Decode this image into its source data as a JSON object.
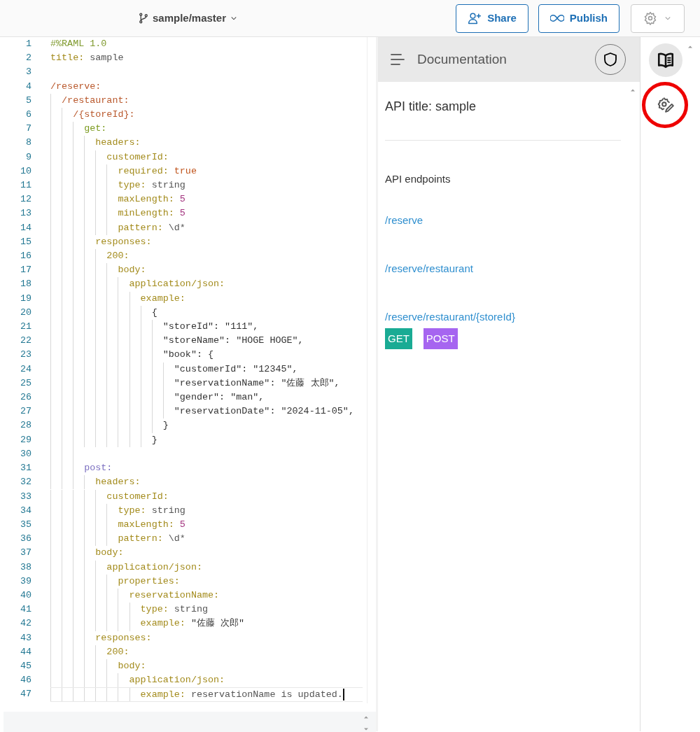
{
  "topbar": {
    "branch": "sample/master",
    "buttons": [
      {
        "kind": "share",
        "label": "Share"
      },
      {
        "kind": "publish",
        "label": "Publish"
      }
    ]
  },
  "editor": {
    "lines": [
      {
        "no": "1",
        "cursor": false,
        "tokens": [
          {
            "kind": "header",
            "text": "#%RAML 1.0"
          }
        ]
      },
      {
        "no": "2",
        "cursor": false,
        "tokens": [
          {
            "kind": "key",
            "text": "title:"
          },
          {
            "kind": "value",
            "text": " sample"
          }
        ]
      },
      {
        "no": "3",
        "cursor": false
      },
      {
        "no": "4",
        "cursor": false,
        "tokens": [
          {
            "kind": "resource",
            "text": "/reserve:"
          }
        ]
      },
      {
        "no": "5",
        "cursor": false,
        "tokens": [
          {
            "kind": "resource",
            "text": "  /restaurant:"
          }
        ]
      },
      {
        "no": "6",
        "cursor": false,
        "tokens": [
          {
            "kind": "resource",
            "text": "    /{storeId}:"
          }
        ]
      },
      {
        "no": "7",
        "cursor": false,
        "tokens": [
          {
            "kind": "get",
            "text": "      get:"
          }
        ]
      },
      {
        "no": "8",
        "cursor": false,
        "tokens": [
          {
            "kind": "key",
            "text": "        headers:"
          }
        ]
      },
      {
        "no": "9",
        "cursor": false,
        "tokens": [
          {
            "kind": "key",
            "text": "          customerId:"
          }
        ]
      },
      {
        "no": "10",
        "cursor": false,
        "tokens": [
          {
            "kind": "key",
            "text": "            required:"
          },
          {
            "kind": "bool",
            "text": " true"
          }
        ]
      },
      {
        "no": "11",
        "cursor": false,
        "tokens": [
          {
            "kind": "key",
            "text": "            type:"
          },
          {
            "kind": "value",
            "text": " string"
          }
        ]
      },
      {
        "no": "12",
        "cursor": false,
        "tokens": [
          {
            "kind": "key",
            "text": "            maxLength:"
          },
          {
            "kind": "number",
            "text": " 5"
          }
        ]
      },
      {
        "no": "13",
        "cursor": false,
        "tokens": [
          {
            "kind": "key",
            "text": "            minLength:"
          },
          {
            "kind": "number",
            "text": " 5"
          }
        ]
      },
      {
        "no": "14",
        "cursor": false,
        "tokens": [
          {
            "kind": "key",
            "text": "            pattern:"
          },
          {
            "kind": "value",
            "text": " \\d*"
          }
        ]
      },
      {
        "no": "15",
        "cursor": false,
        "tokens": [
          {
            "kind": "key",
            "text": "        responses:"
          }
        ]
      },
      {
        "no": "16",
        "cursor": false,
        "tokens": [
          {
            "kind": "key",
            "text": "          200:"
          }
        ]
      },
      {
        "no": "17",
        "cursor": false,
        "tokens": [
          {
            "kind": "key",
            "text": "            body:"
          }
        ]
      },
      {
        "no": "18",
        "cursor": false,
        "tokens": [
          {
            "kind": "key",
            "text": "              application/json:"
          }
        ]
      },
      {
        "no": "19",
        "cursor": false,
        "tokens": [
          {
            "kind": "key",
            "text": "                example:"
          }
        ]
      },
      {
        "no": "20",
        "cursor": false,
        "tokens": [
          {
            "kind": "json",
            "text": "                  {"
          }
        ]
      },
      {
        "no": "21",
        "cursor": false,
        "tokens": [
          {
            "kind": "json",
            "text": "                    \"storeId\": \"111\","
          }
        ]
      },
      {
        "no": "22",
        "cursor": false,
        "tokens": [
          {
            "kind": "json",
            "text": "                    \"storeName\": \"HOGE HOGE\","
          }
        ]
      },
      {
        "no": "23",
        "cursor": false,
        "tokens": [
          {
            "kind": "json",
            "text": "                    \"book\": {"
          }
        ]
      },
      {
        "no": "24",
        "cursor": false,
        "tokens": [
          {
            "kind": "json",
            "text": "                      \"customerId\": \"12345\","
          }
        ]
      },
      {
        "no": "25",
        "cursor": false,
        "tokens": [
          {
            "kind": "json",
            "text": "                      \"reservationName\": \"佐藤 太郎\","
          }
        ]
      },
      {
        "no": "26",
        "cursor": false,
        "tokens": [
          {
            "kind": "json",
            "text": "                      \"gender\": \"man\","
          }
        ]
      },
      {
        "no": "27",
        "cursor": false,
        "tokens": [
          {
            "kind": "json",
            "text": "                      \"reservationDate\": \"2024-11-05\","
          }
        ]
      },
      {
        "no": "28",
        "cursor": false,
        "tokens": [
          {
            "kind": "json",
            "text": "                    }"
          }
        ]
      },
      {
        "no": "29",
        "cursor": false,
        "tokens": [
          {
            "kind": "json",
            "text": "                  }"
          }
        ]
      },
      {
        "no": "30",
        "cursor": false
      },
      {
        "no": "31",
        "cursor": false,
        "tokens": [
          {
            "kind": "post",
            "text": "      post:"
          }
        ]
      },
      {
        "no": "32",
        "cursor": false,
        "tokens": [
          {
            "kind": "key",
            "text": "        headers:"
          }
        ]
      },
      {
        "no": "33",
        "cursor": false,
        "tokens": [
          {
            "kind": "key",
            "text": "          customerId:"
          }
        ]
      },
      {
        "no": "34",
        "cursor": false,
        "tokens": [
          {
            "kind": "key",
            "text": "            type:"
          },
          {
            "kind": "value",
            "text": " string"
          }
        ]
      },
      {
        "no": "35",
        "cursor": false,
        "tokens": [
          {
            "kind": "key",
            "text": "            maxLength:"
          },
          {
            "kind": "number",
            "text": " 5"
          }
        ]
      },
      {
        "no": "36",
        "cursor": false,
        "tokens": [
          {
            "kind": "key",
            "text": "            pattern:"
          },
          {
            "kind": "value",
            "text": " \\d*"
          }
        ]
      },
      {
        "no": "37",
        "cursor": false,
        "tokens": [
          {
            "kind": "key",
            "text": "        body:"
          }
        ]
      },
      {
        "no": "38",
        "cursor": false,
        "tokens": [
          {
            "kind": "key",
            "text": "          application/json:"
          }
        ]
      },
      {
        "no": "39",
        "cursor": false,
        "tokens": [
          {
            "kind": "key",
            "text": "            properties:"
          }
        ]
      },
      {
        "no": "40",
        "cursor": false,
        "tokens": [
          {
            "kind": "key",
            "text": "              reservationName:"
          }
        ]
      },
      {
        "no": "41",
        "cursor": false,
        "tokens": [
          {
            "kind": "key",
            "text": "                type:"
          },
          {
            "kind": "value",
            "text": " string"
          }
        ]
      },
      {
        "no": "42",
        "cursor": false,
        "tokens": [
          {
            "kind": "key",
            "text": "                example:"
          },
          {
            "kind": "json",
            "text": " \"佐藤 次郎\""
          }
        ]
      },
      {
        "no": "43",
        "cursor": false,
        "tokens": [
          {
            "kind": "key",
            "text": "        responses:"
          }
        ]
      },
      {
        "no": "44",
        "cursor": false,
        "tokens": [
          {
            "kind": "key",
            "text": "          200:"
          }
        ]
      },
      {
        "no": "45",
        "cursor": false,
        "tokens": [
          {
            "kind": "key",
            "text": "            body:"
          }
        ]
      },
      {
        "no": "46",
        "cursor": false,
        "tokens": [
          {
            "kind": "key",
            "text": "              application/json:"
          }
        ]
      },
      {
        "no": "47",
        "cursor": true,
        "tokens": [
          {
            "kind": "key",
            "text": "                example:"
          },
          {
            "kind": "value",
            "text": " reservationName is updated."
          }
        ]
      }
    ]
  },
  "documentation": {
    "title": "Documentation",
    "api_title": "API title: sample",
    "endpoints_heading": "API endpoints",
    "endpoints": [
      {
        "path": "/reserve"
      },
      {
        "path": "/reserve/restaurant"
      },
      {
        "path": "/reserve/restaurant/{storeId}",
        "methods": [
          {
            "label": "GET",
            "color": "#1aab94"
          },
          {
            "label": "POST",
            "color": "#a665f0"
          }
        ]
      }
    ]
  },
  "rail": [
    {
      "kind": "docs",
      "selected": true
    },
    {
      "kind": "settings",
      "selected": false
    }
  ]
}
